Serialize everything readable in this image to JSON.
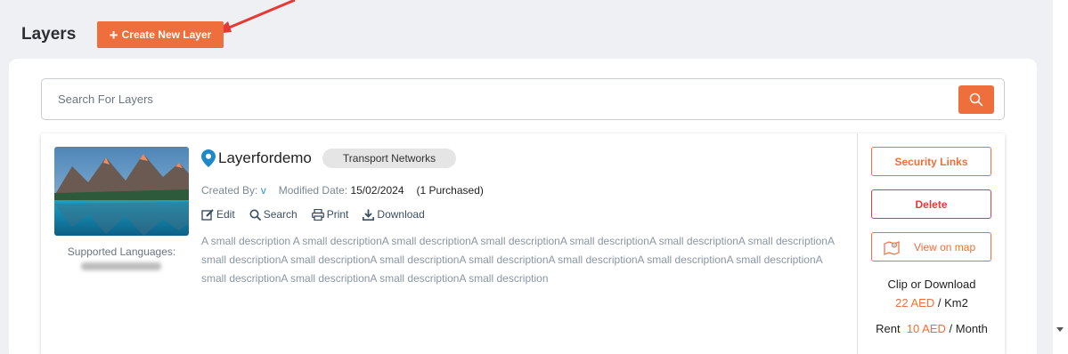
{
  "header": {
    "title": "Layers",
    "create_button_label": "Create New Layer"
  },
  "search": {
    "placeholder": "Search For Layers",
    "value": ""
  },
  "layer": {
    "name": "Layerfordemo",
    "category": "Transport Networks",
    "created_by_label": "Created By:",
    "created_by_value": "v",
    "modified_label": "Modified Date:",
    "modified_value": "15/02/2024",
    "purchased": "(1 Purchased)",
    "actions": {
      "edit": "Edit",
      "search": "Search",
      "print": "Print",
      "download": "Download"
    },
    "description": "A small description A small descriptionA small descriptionA small descriptionA small descriptionA small descriptionA small descriptionA small descriptionA small descriptionA small descriptionA small descriptionA small descriptionA small descriptionA small descriptionA small descriptionA small descriptionA small descriptionA small description",
    "supported_languages_label": "Supported Languages:",
    "buttons": {
      "security_links": "Security Links",
      "delete": "Delete",
      "view_on_map": "View on map"
    },
    "pricing": {
      "clip_label": "Clip or Download",
      "clip_price": "22 AED",
      "clip_unit": "/ Km2",
      "rent_label": "Rent",
      "rent_price": "10 AED",
      "rent_unit": "/ Month"
    }
  },
  "colors": {
    "accent": "#ee6f3b",
    "danger": "#d7413c",
    "link": "#2196e0",
    "background": "#eef0f3"
  }
}
